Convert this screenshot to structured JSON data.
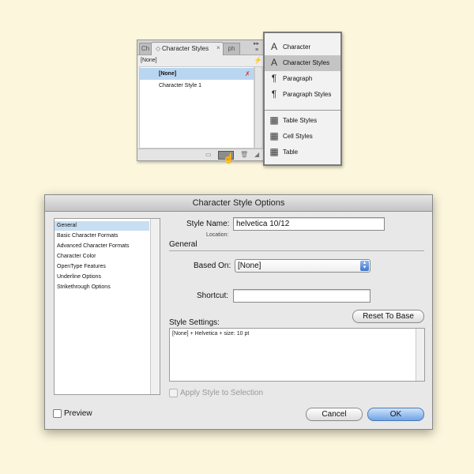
{
  "character_styles_panel": {
    "tab_left_label": "Ch",
    "tab_active_label": "Character Styles",
    "tab_right_label": "ph",
    "current_style": "[None]",
    "items": [
      {
        "label": "[None]",
        "selected": true
      },
      {
        "label": "Character Style 1",
        "selected": false
      }
    ],
    "icons": {
      "tab_dot": "◇",
      "tab_close": "×",
      "flyout_arrows": "▸▸",
      "menu": "≡",
      "quick_apply": "⚡",
      "override": "✗",
      "folder": "▭",
      "trash": "🗑",
      "resize": "◢"
    }
  },
  "menu_strip": {
    "items": [
      {
        "label": "Character",
        "icon": "A",
        "active": false
      },
      {
        "label": "Character Styles",
        "icon": "A",
        "active": true
      },
      {
        "label": "Paragraph",
        "icon": "¶",
        "active": false
      },
      {
        "label": "Paragraph Styles",
        "icon": "¶",
        "active": false
      },
      {
        "label": "Table Styles",
        "icon": "▦",
        "active": false
      },
      {
        "label": "Cell Styles",
        "icon": "▦",
        "active": false
      },
      {
        "label": "Table",
        "icon": "▦",
        "active": false
      }
    ]
  },
  "dialog": {
    "title": "Character Style Options",
    "sidebar": [
      {
        "label": "General",
        "selected": true
      },
      {
        "label": "Basic Character Formats",
        "selected": false
      },
      {
        "label": "Advanced Character Formats",
        "selected": false
      },
      {
        "label": "Character Color",
        "selected": false
      },
      {
        "label": "OpenType Features",
        "selected": false
      },
      {
        "label": "Underline Options",
        "selected": false
      },
      {
        "label": "Strikethrough Options",
        "selected": false
      }
    ],
    "style_name_label": "Style Name:",
    "style_name_value": "helvetica 10/12",
    "location_label": "Location:",
    "section_general": "General",
    "based_on_label": "Based On:",
    "based_on_value": "[None]",
    "shortcut_label": "Shortcut:",
    "shortcut_value": "",
    "reset_button": "Reset To Base",
    "style_settings_label": "Style Settings:",
    "style_settings_text": "[None] + Helvetica + size: 10 pt",
    "apply_label": "Apply Style to Selection",
    "preview_label": "Preview",
    "cancel_button": "Cancel",
    "ok_button": "OK"
  },
  "colors": {
    "background": "#fbf6dc",
    "selection": "#b9d6f1",
    "ok_button": "#6fa4e6"
  }
}
